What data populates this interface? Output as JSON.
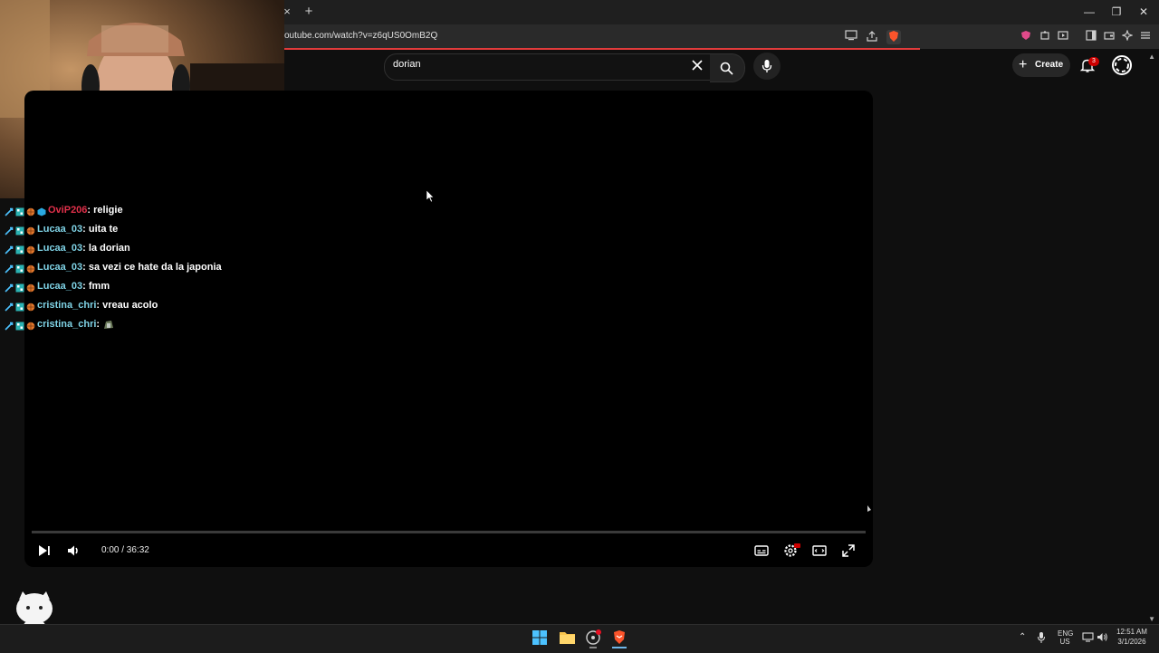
{
  "browser": {
    "url": "outube.com/watch?v=z6qUS0OmB2Q",
    "tab_close": "×",
    "new_tab": "+",
    "accent": "#e23b3b"
  },
  "youtube": {
    "search_query": "dorian",
    "create_label": "Create",
    "notification_count": "3"
  },
  "player": {
    "time": "0:00 / 36:32",
    "progress_fraction": 0
  },
  "chat": [
    {
      "user": "OviP206",
      "message": "religie",
      "user_color": "#e0304a"
    },
    {
      "user": "Lucaa_03",
      "message": "uita te",
      "user_color": "#7fd3e6"
    },
    {
      "user": "Lucaa_03",
      "message": "la dorian",
      "user_color": "#7fd3e6"
    },
    {
      "user": "Lucaa_03",
      "message": "sa vezi ce hate da la japonia",
      "user_color": "#7fd3e6"
    },
    {
      "user": "Lucaa_03",
      "message": "fmm",
      "user_color": "#7fd3e6"
    },
    {
      "user": "cristina_chri",
      "message": "vreau acolo",
      "user_color": "#7fd3e6"
    },
    {
      "user": "cristina_chri",
      "message": "",
      "user_color": "#7fd3e6",
      "emote": "emote-icon"
    }
  ],
  "taskbar": {
    "lang_top": "ENG",
    "lang_bottom": "US",
    "time": "12:51 AM",
    "date": "3/1/2026"
  }
}
